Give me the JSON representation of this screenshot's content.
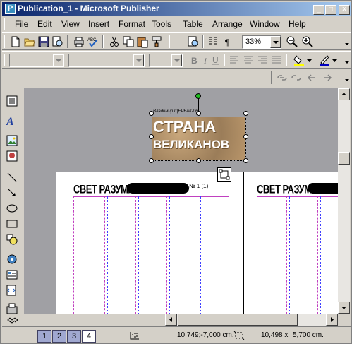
{
  "window": {
    "title": "Publication_1 - Microsoft Publisher"
  },
  "menu": [
    "File",
    "Edit",
    "View",
    "Insert",
    "Format",
    "Tools",
    "Table",
    "Arrange",
    "Window",
    "Help"
  ],
  "toolbar": {
    "zoom_value": "33%"
  },
  "canvas": {
    "wordart_line1": "СТРАНА",
    "wordart_line2": "ВЕЛИКАНОВ",
    "wordart_caption": "Владимир ЩЕРБАК-06",
    "page1_header": "СВЕТ РАЗУМА",
    "page1_issue": "№ 1 (1)",
    "page2_header": "СВЕТ РАЗУМА"
  },
  "status": {
    "pages": [
      "1",
      "2",
      "3",
      "4"
    ],
    "active_page": "4",
    "position": "10,749;-7,000 cm.",
    "size_w": "10,498 x",
    "size_h": "5,700 cm."
  },
  "colors": {
    "title_start": "#0a246a",
    "title_end": "#a6caf0",
    "workspace": "#a0a0a4",
    "guide": "#c040c0"
  }
}
